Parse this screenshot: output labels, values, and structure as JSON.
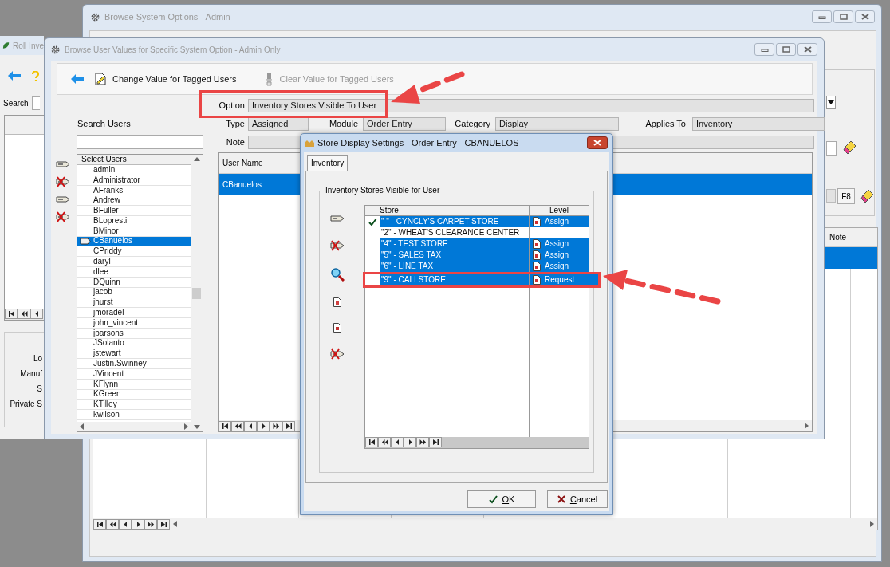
{
  "roll_window": {
    "title": "Roll Inve",
    "search_label": "Search",
    "labels": [
      "Lo",
      "Manuf",
      "S",
      "Private S"
    ]
  },
  "system_options_window": {
    "title": "Browse System Options - Admin",
    "f8_button": "F8",
    "grid_header": "Note",
    "grid_rows": [
      {
        "selected": true
      }
    ]
  },
  "user_values_window": {
    "title": "Browse User Values for Specific System Option - Admin Only",
    "toolbar": [
      {
        "label": "Change Value for Tagged Users",
        "disabled": false
      },
      {
        "label": "Clear Value for Tagged Users",
        "disabled": true
      }
    ],
    "option": {
      "label": "Option",
      "value": "Inventory Stores Visible To User"
    },
    "type": {
      "label": "Type",
      "value": "Assigned"
    },
    "module": {
      "label": "Module",
      "value": "Order Entry"
    },
    "category": {
      "label": "Category",
      "value": "Display"
    },
    "applies_to": {
      "label": "Applies To",
      "value": "Inventory"
    },
    "note": {
      "label": "Note"
    },
    "search_label": "Search Users",
    "users_header": "Select Users",
    "users": [
      {
        "name": "admin",
        "selected": false
      },
      {
        "name": "Administrator",
        "selected": false
      },
      {
        "name": "AFranks",
        "selected": false
      },
      {
        "name": "Andrew",
        "selected": false
      },
      {
        "name": "BFuller",
        "selected": false
      },
      {
        "name": "BLopresti",
        "selected": false
      },
      {
        "name": "BMinor",
        "selected": false
      },
      {
        "name": "CBanuelos",
        "selected": true
      },
      {
        "name": "CPriddy",
        "selected": false
      },
      {
        "name": "daryl",
        "selected": false
      },
      {
        "name": "dlee",
        "selected": false
      },
      {
        "name": "DQuinn",
        "selected": false
      },
      {
        "name": "jacob",
        "selected": false
      },
      {
        "name": "jhurst",
        "selected": false
      },
      {
        "name": "jmoradel",
        "selected": false
      },
      {
        "name": "john_vincent",
        "selected": false
      },
      {
        "name": "jparsons",
        "selected": false
      },
      {
        "name": "JSolanto",
        "selected": false
      },
      {
        "name": "jstewart",
        "selected": false
      },
      {
        "name": "Justin.Swinney",
        "selected": false
      },
      {
        "name": "JVincent",
        "selected": false
      },
      {
        "name": "KFlynn",
        "selected": false
      },
      {
        "name": "KGreen",
        "selected": false
      },
      {
        "name": "KTilley",
        "selected": false
      },
      {
        "name": "kwilson",
        "selected": false
      }
    ],
    "grid_header": "User Name",
    "grid_rows": [
      {
        "user_name": "CBanuelos",
        "selected": true
      }
    ]
  },
  "dialog": {
    "title": "Store Display Settings - Order Entry - CBANUELOS",
    "tabs": [
      {
        "label": "Inventory",
        "selected": true
      }
    ],
    "group_title": "Inventory Stores Visible for User",
    "columns": [
      "Store",
      "Level"
    ],
    "rows": [
      {
        "store": "\" \" - CYNCLY'S CARPET STORE",
        "level": "Assign",
        "checked": true,
        "selected": true,
        "highlighted": false
      },
      {
        "store": "\"2\" - WHEAT'S CLEARANCE CENTER",
        "checked": false,
        "selected": false,
        "highlighted": false
      },
      {
        "store": "\"4\" - TEST STORE",
        "level": "Assign",
        "checked": false,
        "selected": true,
        "highlighted": false
      },
      {
        "store": "\"5\" - SALES TAX",
        "level": "Assign",
        "checked": false,
        "selected": true,
        "highlighted": false
      },
      {
        "store": "\"6\" - LINE TAX",
        "level": "Assign",
        "checked": false,
        "selected": true,
        "highlighted": false
      },
      {
        "store": "\"9\" - CALI STORE",
        "level": "Request",
        "checked": false,
        "selected": true,
        "highlighted": true
      }
    ],
    "buttons": [
      {
        "label": "OK",
        "kind": "ok"
      },
      {
        "label": "Cancel",
        "kind": "cancel"
      }
    ]
  }
}
